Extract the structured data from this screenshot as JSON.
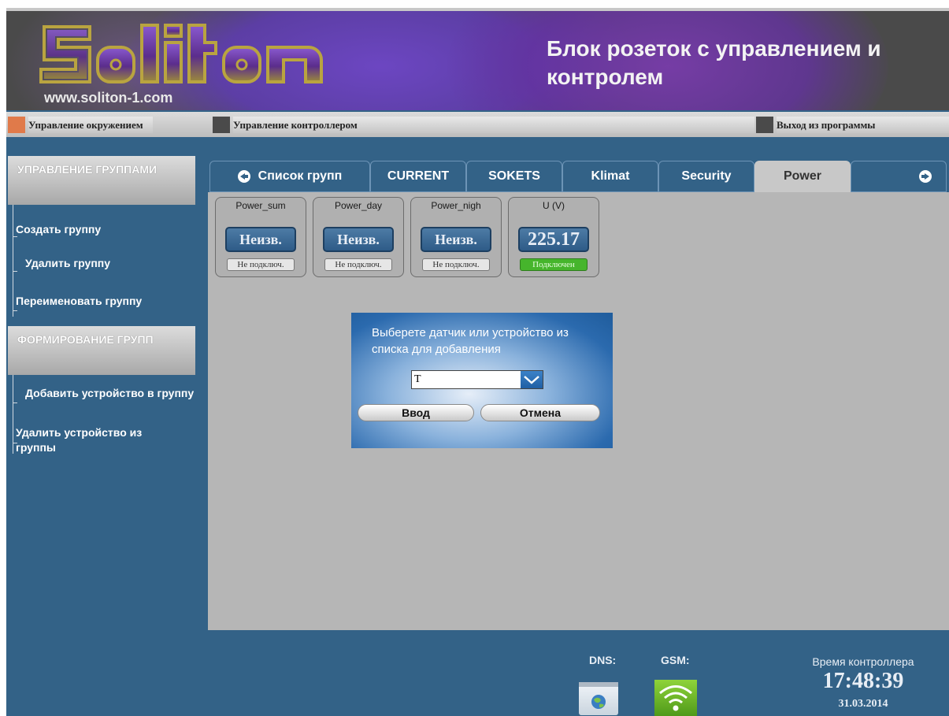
{
  "header": {
    "logo_text": "Soliton",
    "url": "www.soliton-1.com",
    "title": "Блок розеток с управлением и контролем"
  },
  "menubar": {
    "items": [
      {
        "label": "Управление окружением",
        "color": "#e07a4a"
      },
      {
        "label": "Управление контроллером",
        "color": "#4a4a4a"
      },
      {
        "label": "Выход из программы",
        "color": "#4a4a4a"
      }
    ]
  },
  "sidebar": {
    "section1": "УПРАВЛЕНИЕ ГРУППАМИ",
    "group_items": [
      "Создать группу",
      "Удалить группу",
      "Переименовать группу"
    ],
    "section2": "ФОРМИРОВАНИЕ ГРУПП",
    "form_items": [
      "Добавить устройство в группу",
      "Удалить устройство из группы"
    ]
  },
  "tabs": {
    "back_label": "Список групп",
    "items": [
      "CURRENT",
      "SOKETS",
      "Klimat",
      "Security",
      "Power"
    ],
    "active": "Power"
  },
  "cards": [
    {
      "name": "Power_sum",
      "value": "Неизв.",
      "status": "Не подключ.",
      "connected": false
    },
    {
      "name": "Power_day",
      "value": "Неизв.",
      "status": "Не подключ.",
      "connected": false
    },
    {
      "name": "Power_nigh",
      "value": "Неизв.",
      "status": "Не подключ.",
      "connected": false
    },
    {
      "name": "U (V)",
      "value": "225.17",
      "status": "Подключен",
      "connected": true
    }
  ],
  "dialog": {
    "message": "Выберете датчик или устройство из списка для добавления",
    "select_value": "T",
    "ok_label": "Ввод",
    "cancel_label": "Отмена"
  },
  "status": {
    "dns_label": "DNS:",
    "gsm_label": "GSM:",
    "clock_label": "Время контроллера",
    "time": "17:48:39",
    "date": "31.03.2014"
  },
  "colors": {
    "background": "#336287",
    "panel": "#b6b6b6",
    "connected": "#46b52c"
  }
}
